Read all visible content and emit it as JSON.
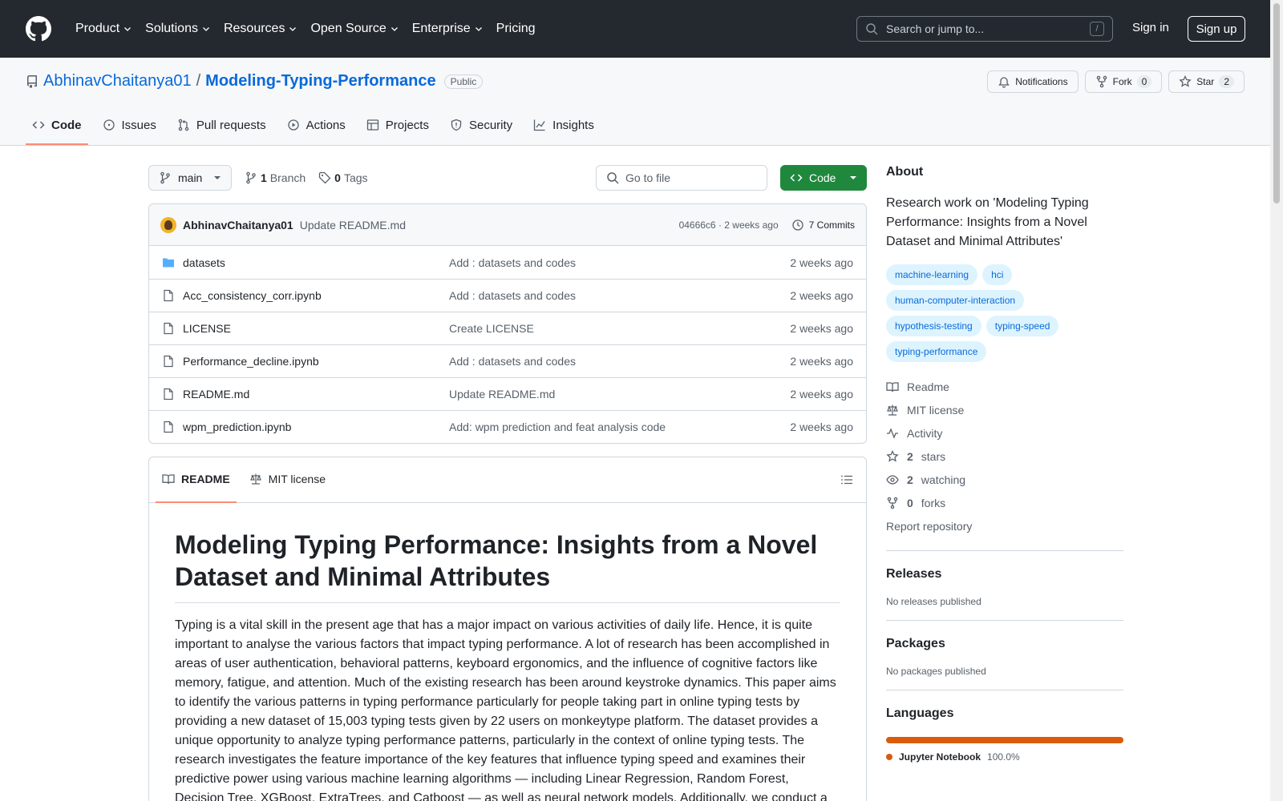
{
  "header": {
    "nav": [
      {
        "label": "Product",
        "dropdown": true
      },
      {
        "label": "Solutions",
        "dropdown": true
      },
      {
        "label": "Resources",
        "dropdown": true
      },
      {
        "label": "Open Source",
        "dropdown": true
      },
      {
        "label": "Enterprise",
        "dropdown": true
      },
      {
        "label": "Pricing",
        "dropdown": false
      }
    ],
    "search_placeholder": "Search or jump to...",
    "search_shortcut": "/",
    "sign_in": "Sign in",
    "sign_up": "Sign up"
  },
  "repo": {
    "owner": "AbhinavChaitanya01",
    "separator": "/",
    "name": "Modeling-Typing-Performance",
    "visibility": "Public",
    "notifications_label": "Notifications",
    "fork_label": "Fork",
    "fork_count": "0",
    "star_label": "Star",
    "star_count": "2",
    "tabs": [
      {
        "label": "Code",
        "icon": "code-icon",
        "active": true
      },
      {
        "label": "Issues",
        "icon": "issue-icon",
        "active": false
      },
      {
        "label": "Pull requests",
        "icon": "pull-request-icon",
        "active": false
      },
      {
        "label": "Actions",
        "icon": "play-icon",
        "active": false
      },
      {
        "label": "Projects",
        "icon": "table-icon",
        "active": false
      },
      {
        "label": "Security",
        "icon": "shield-icon",
        "active": false
      },
      {
        "label": "Insights",
        "icon": "graph-icon",
        "active": false
      }
    ]
  },
  "toolbar": {
    "branch": "main",
    "branch_count": "1",
    "branch_label": "Branch",
    "tag_count": "0",
    "tag_label": "Tags",
    "goto_placeholder": "Go to file",
    "code_button": "Code"
  },
  "commit": {
    "author": "AbhinavChaitanya01",
    "message": "Update README.md",
    "hash_time": "04666c6 · 2 weeks ago",
    "commits_label": "7 Commits"
  },
  "files": [
    {
      "name": "datasets",
      "type": "folder",
      "message": "Add : datasets and codes",
      "time": "2 weeks ago"
    },
    {
      "name": "Acc_consistency_corr.ipynb",
      "type": "file",
      "message": "Add : datasets and codes",
      "time": "2 weeks ago"
    },
    {
      "name": "LICENSE",
      "type": "file",
      "message": "Create LICENSE",
      "time": "2 weeks ago"
    },
    {
      "name": "Performance_decline.ipynb",
      "type": "file",
      "message": "Add : datasets and codes",
      "time": "2 weeks ago"
    },
    {
      "name": "README.md",
      "type": "file",
      "message": "Update README.md",
      "time": "2 weeks ago"
    },
    {
      "name": "wpm_prediction.ipynb",
      "type": "file",
      "message": "Add: wpm prediction and feat analysis code",
      "time": "2 weeks ago"
    }
  ],
  "readme": {
    "tab_readme": "README",
    "tab_license": "MIT license",
    "title": "Modeling Typing Performance: Insights from a Novel Dataset and Minimal Attributes",
    "body": "Typing is a vital skill in the present age that has a major impact on various activities of daily life. Hence, it is quite important to analyse the various factors that impact typing performance. A lot of research has been accomplished in areas of user authentication, behavioral patterns, keyboard ergonomics, and the influence of cognitive factors like memory, fatigue, and attention. Much of the existing research has been around keystroke dynamics. This paper aims to identify the various patterns in typing performance particularly for people taking part in online typing tests by providing a new dataset of 15,003 typing tests given by 22 users on monkeytype platform. The dataset provides a unique opportunity to analyze typing performance patterns, particularly in the context of online typing tests. The research investigates the feature importance of the key features that influence typing speed and examines their predictive power using various machine learning algorithms — including Linear Regression, Random Forest, Decision Tree, XGBoost, ExtraTrees, and Catboost — as well as neural network models. Additionally, we conduct a"
  },
  "sidebar": {
    "about_title": "About",
    "description": "Research work on 'Modeling Typing Performance: Insights from a Novel Dataset and Minimal Attributes'",
    "topics": [
      "machine-learning",
      "hci",
      "human-computer-interaction",
      "hypothesis-testing",
      "typing-speed",
      "typing-performance"
    ],
    "links": [
      {
        "icon": "book-icon",
        "bold": "",
        "label": "Readme"
      },
      {
        "icon": "law-icon",
        "bold": "",
        "label": "MIT license"
      },
      {
        "icon": "pulse-icon",
        "bold": "",
        "label": "Activity"
      },
      {
        "icon": "star-icon",
        "bold": "2",
        "label": "stars"
      },
      {
        "icon": "eye-icon",
        "bold": "2",
        "label": "watching"
      },
      {
        "icon": "fork-icon",
        "bold": "0",
        "label": "forks"
      }
    ],
    "report": "Report repository",
    "releases_title": "Releases",
    "releases_text": "No releases published",
    "packages_title": "Packages",
    "packages_text": "No packages published",
    "languages_title": "Languages",
    "language": {
      "name": "Jupyter Notebook",
      "percent": "100.0%",
      "color": "#da5b0b"
    }
  }
}
